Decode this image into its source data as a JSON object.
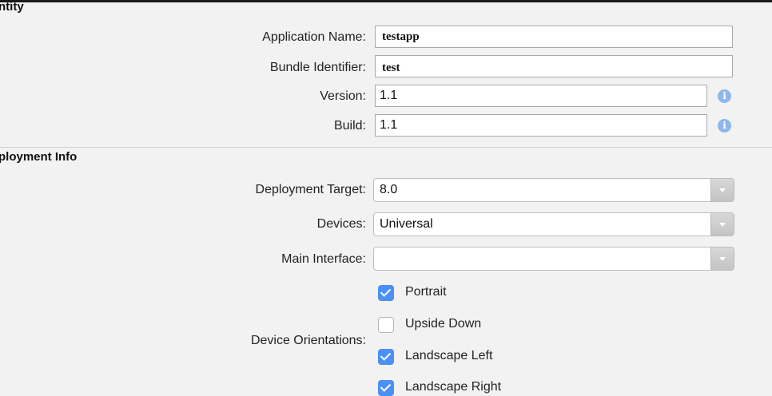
{
  "identity": {
    "section_title": "ntity",
    "app_name_label": "Application Name:",
    "app_name_value": "testapp",
    "bundle_label": "Bundle Identifier:",
    "bundle_value": "test",
    "version_label": "Version:",
    "version_value": "1.1",
    "build_label": "Build:",
    "build_value": "1.1",
    "info_glyph": "i"
  },
  "deployment": {
    "section_title": "ployment Info",
    "target_label": "Deployment Target:",
    "target_value": "8.0",
    "devices_label": "Devices:",
    "devices_value": "Universal",
    "main_interface_label": "Main Interface:",
    "main_interface_value": "",
    "orientations_label": "Device Orientations:",
    "orientations": [
      {
        "label": "Portrait",
        "checked": true
      },
      {
        "label": "Upside Down",
        "checked": false
      },
      {
        "label": "Landscape Left",
        "checked": true
      },
      {
        "label": "Landscape Right",
        "checked": true
      }
    ]
  },
  "colors": {
    "accent": "#4b90f5",
    "info": "#8fb7ec"
  },
  "icons": {
    "info": "info-icon",
    "dropdown": "chevron-down-icon",
    "check": "checkmark-icon"
  }
}
